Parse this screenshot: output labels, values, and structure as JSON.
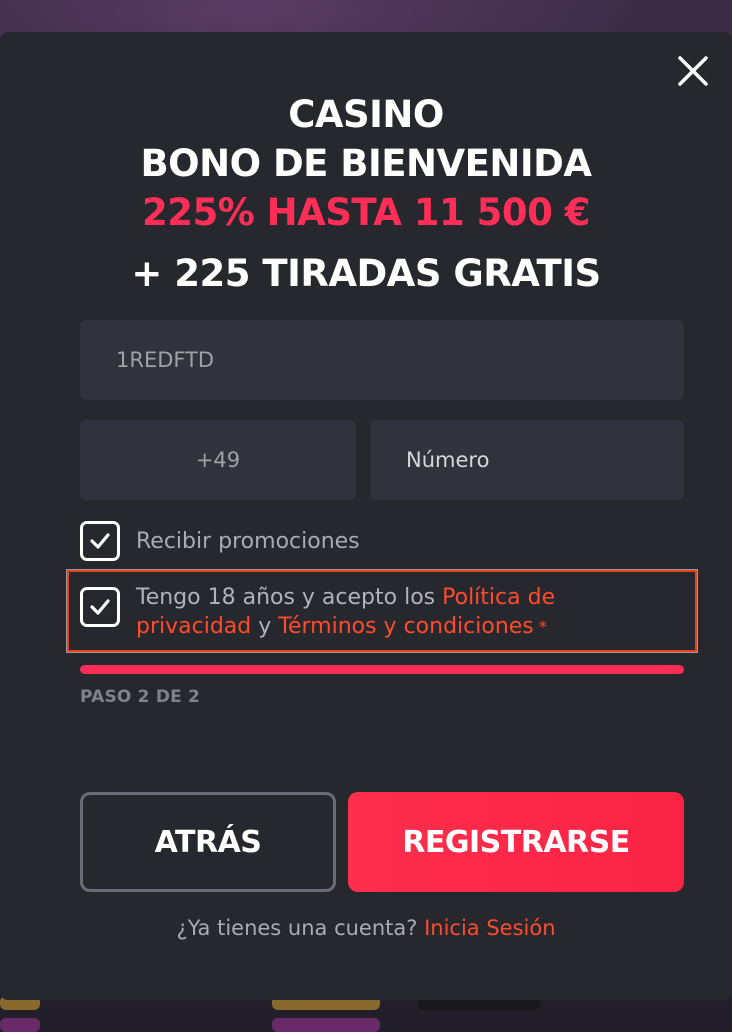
{
  "header": {
    "line1": "CASINO",
    "line2": "BONO DE BIENVENIDA",
    "line3": "225% HASTA 11 500 €",
    "line4": "+ 225 TIRADAS GRATIS"
  },
  "form": {
    "promo_code_value": "1REDFTD",
    "phone_prefix_value": "+49",
    "phone_number_placeholder": "Número"
  },
  "checkboxes": {
    "promotions_label": "Recibir promociones",
    "terms_prefix": "Tengo 18 años y acepto los ",
    "privacy_link": "Política de privacidad",
    "terms_conjunction": " y ",
    "terms_link": "Términos y condiciones",
    "required_mark": " *"
  },
  "progress": {
    "step_text": "PASO 2 DE 2",
    "fraction": 1.0
  },
  "buttons": {
    "back_label": "ATRÁS",
    "register_label": "REGISTRARSE"
  },
  "footer": {
    "question": "¿Ya tienes una cuenta? ",
    "login_link": "Inicia Sesión"
  },
  "icons": {
    "close": "close-icon",
    "check": "checkmark-icon"
  },
  "colors": {
    "accent": "#ff2e56",
    "link": "#ff4b2b",
    "modal_bg": "#27282e",
    "field_bg": "#31323b"
  }
}
